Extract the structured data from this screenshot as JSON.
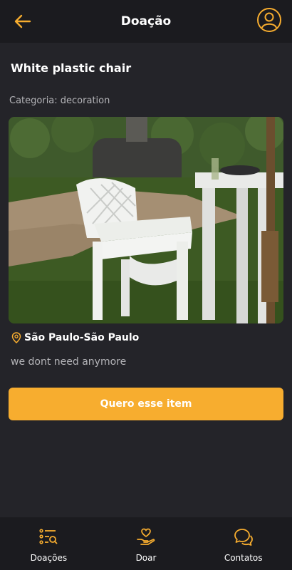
{
  "header": {
    "title": "Doação"
  },
  "item": {
    "title": "White plastic chair",
    "category": "Categoria: decoration",
    "location": "São Paulo-São Paulo",
    "description": "we dont need anymore"
  },
  "cta": {
    "label": "Quero esse item"
  },
  "tabs": [
    {
      "label": "Doações",
      "icon": "list-search-icon"
    },
    {
      "label": "Doar",
      "icon": "heart-hand-icon"
    },
    {
      "label": "Contatos",
      "icon": "chat-bubbles-icon"
    }
  ],
  "colors": {
    "accent": "#f7ad2f",
    "background": "#242429",
    "bar": "#1b1b1f"
  }
}
